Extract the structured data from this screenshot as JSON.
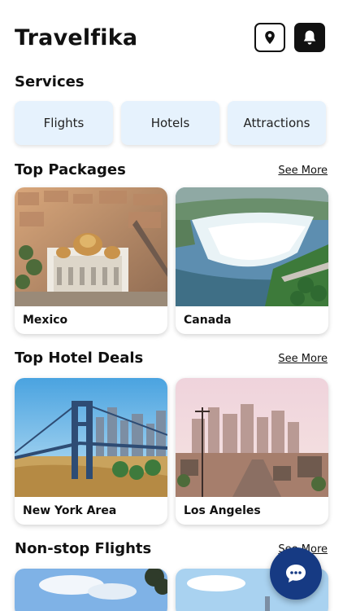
{
  "header": {
    "title": "Travelfika"
  },
  "icons": {
    "location": "location-pin-icon",
    "notifications": "bell-icon",
    "chat": "chat-bubble-icon"
  },
  "services": {
    "title": "Services",
    "items": [
      {
        "label": "Flights"
      },
      {
        "label": "Hotels"
      },
      {
        "label": "Attractions"
      }
    ]
  },
  "top_packages": {
    "title": "Top Packages",
    "see_more": "See More",
    "items": [
      {
        "label": "Mexico"
      },
      {
        "label": "Canada"
      }
    ]
  },
  "top_hotel_deals": {
    "title": "Top Hotel Deals",
    "see_more": "See More",
    "items": [
      {
        "label": "New York Area"
      },
      {
        "label": "Los Angeles"
      }
    ]
  },
  "nonstop_flights": {
    "title": "Non-stop Flights",
    "see_more": "See More"
  },
  "colors": {
    "service_bg": "#e6f2fd",
    "fab": "#163a83"
  }
}
